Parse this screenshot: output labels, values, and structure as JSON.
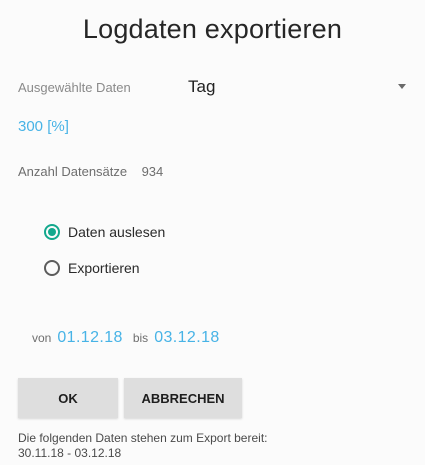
{
  "dialog": {
    "title": "Logdaten exportieren",
    "selected_data_label": "Ausgewählte Daten",
    "selected_data_value": "Tag",
    "unit": "300 [%]",
    "record_count_label": "Anzahl Datensätze",
    "record_count_value": "934",
    "options": [
      {
        "label": "Daten auslesen",
        "selected": true
      },
      {
        "label": "Exportieren",
        "selected": false
      }
    ],
    "from_label": "von",
    "from_date": "01.12.18",
    "to_label": "bis",
    "to_date": "03.12.18",
    "ok_label": "OK",
    "cancel_label": "ABBRECHEN",
    "info_line1": "Die folgenden Daten stehen zum Export bereit:",
    "info_line2": "30.11.18 - 03.12.18"
  },
  "colors": {
    "accent_blue": "#47b3e6",
    "radio_green": "#13a88d"
  }
}
